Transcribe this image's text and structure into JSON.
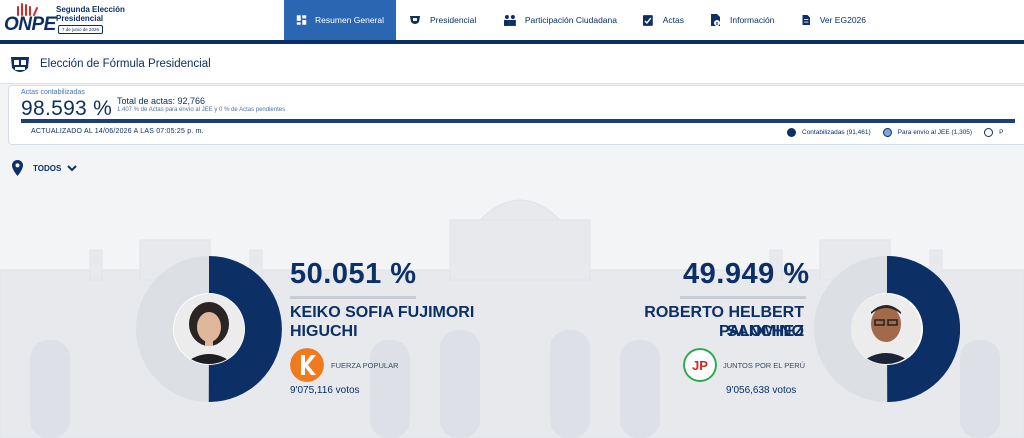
{
  "header": {
    "logo_text": "ONPE",
    "logo_title": "Segunda Elección Presidencial",
    "logo_date": "7 de junio de 2026"
  },
  "nav": [
    {
      "label": "Resumen General",
      "icon": "dashboard-icon",
      "active": true
    },
    {
      "label": "Presidencial",
      "icon": "seal-icon",
      "active": false
    },
    {
      "label": "Participación Ciudadana",
      "icon": "people-icon",
      "active": false
    },
    {
      "label": "Actas",
      "icon": "clipboard-check-icon",
      "active": false
    },
    {
      "label": "Información",
      "icon": "document-info-icon",
      "active": false
    },
    {
      "label": "Ver EG2026",
      "icon": "document-icon",
      "active": false
    }
  ],
  "page": {
    "title": "Elección de Fórmula Presidencial"
  },
  "summary": {
    "actas_label": "Actas contabilizadas",
    "actas_pct": "98.593 %",
    "total_label": "Total de actas: 92,766",
    "total_sub": "1.407 % de Actas para envío al JEE y 0 % de Actas pendientes",
    "progress_pct": 98.593,
    "updated": "ACTUALIZADO AL 14/06/2026 A LAS 07:05:25 p. m.",
    "legend": [
      {
        "label": "Contabilizadas (91,461)",
        "color": "#0c2f66"
      },
      {
        "label": "Para envío al JEE (1,305)",
        "color": "#7fa5d9"
      },
      {
        "label": "P",
        "color": "#ffffff"
      }
    ]
  },
  "filter": {
    "label": "TODOS"
  },
  "candidates": [
    {
      "pct": "50.051 %",
      "share": 50.051,
      "name_line1": "KEIKO SOFIA FUJIMORI",
      "name_line2": "HIGUCHI",
      "party": "FUERZA POPULAR",
      "party_color": "#f07a1e",
      "votes": "9'075,116 votos"
    },
    {
      "pct": "49.949 %",
      "share": 49.949,
      "name_line1": "ROBERTO HELBERT SANCHEZ",
      "name_line2": "PALOMINO",
      "party": "JUNTOS POR EL PERÚ",
      "party_color": "#2aa84a",
      "votes": "9'056,638 votos"
    }
  ],
  "colors": {
    "navy": "#0c2f66",
    "active_tab": "#2b66b3",
    "donut_rest": "#dcdfe4"
  }
}
